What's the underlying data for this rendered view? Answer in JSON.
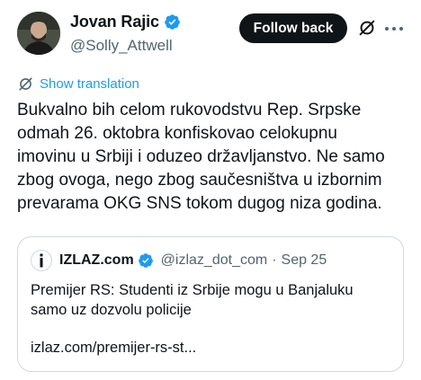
{
  "author": {
    "display_name": "Jovan Rajic",
    "handle": "@Solly_Attwell"
  },
  "actions": {
    "follow_label": "Follow back",
    "grok_icon": "grok-slash-icon",
    "more_icon": "ellipsis-icon"
  },
  "translate": {
    "label": "Show translation"
  },
  "tweet": {
    "lines": [
      "Bukvalno bih celom rukovodstvu Rep. Srpske",
      "odmah 26. oktobra konfiskovao celokupnu",
      "imovinu u Srbiji i oduzeo državljanstvo. Ne samo",
      "zbog ovoga, nego zbog saučesništva u izbornim",
      "prevarama OKG SNS tokom dugog niza godina."
    ]
  },
  "quote": {
    "name": "IZLAZ.com",
    "handle": "@izlaz_dot_com",
    "separator": "·",
    "date": "Sep 25",
    "lines": [
      "Premijer RS: Studenti iz Srbije mogu u Banjaluku",
      "samo uz dozvolu policije"
    ],
    "link": "izlaz.com/premijer-rs-st..."
  },
  "colors": {
    "accent": "#1d9bf0",
    "text": "#0f1419",
    "secondary": "#536471",
    "border": "#cfd9de"
  }
}
